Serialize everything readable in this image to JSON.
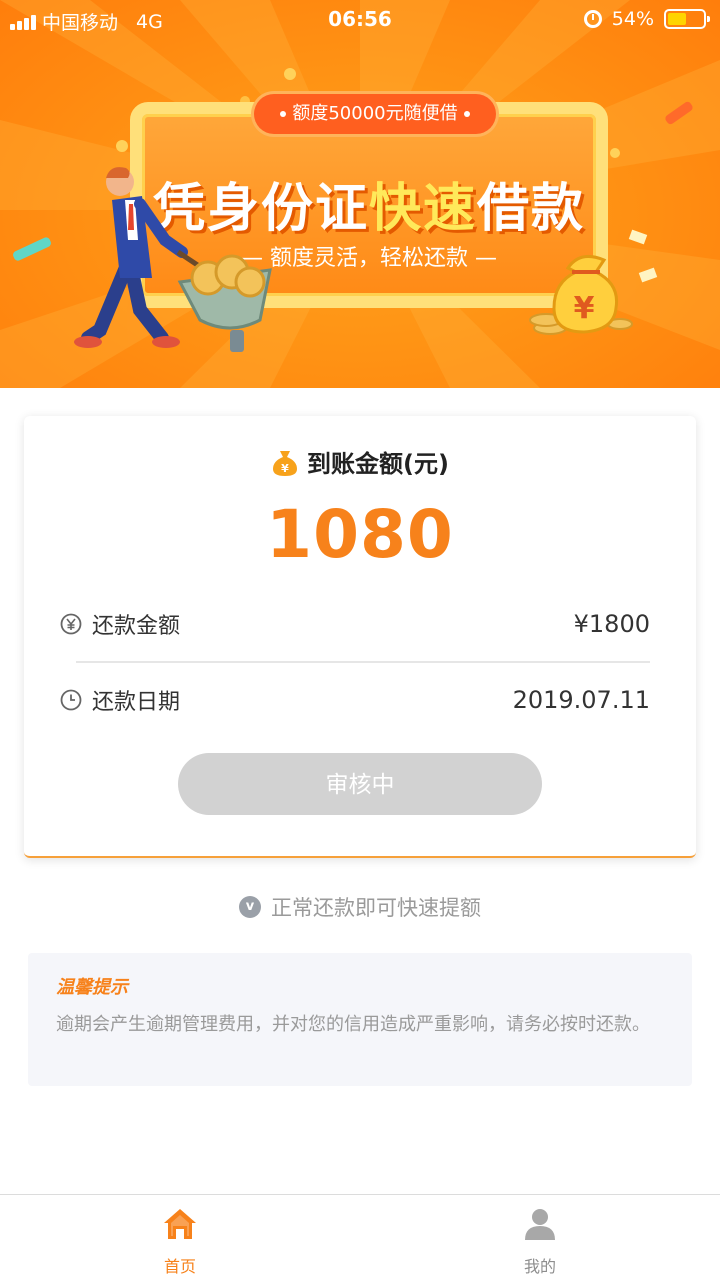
{
  "status_bar": {
    "carrier": "中国移动",
    "network": "4G",
    "time": "06:56",
    "battery_percent": "54%",
    "battery_level": 0.54
  },
  "banner": {
    "pill_text": "额度50000元随便借",
    "headline_part1": "凭身份证",
    "headline_highlight": "快速",
    "headline_part2": "借款",
    "subline": "— 额度灵活，轻松还款 —",
    "coin_symbol": "¥"
  },
  "card": {
    "title": "到账金额(元)",
    "amount": "1080",
    "repay_amount_label": "还款金额",
    "repay_amount_value": "¥1800",
    "repay_date_label": "还款日期",
    "repay_date_value": "2019.07.11",
    "status_button": "审核中"
  },
  "tip": {
    "icon_text": "v",
    "text": "正常还款即可快速提额"
  },
  "notice": {
    "title": "温馨提示",
    "body": "逾期会产生逾期管理费用，并对您的信用造成严重影响，请务必按时还款。"
  },
  "tabbar": {
    "home_label": "首页",
    "me_label": "我的"
  },
  "colors": {
    "accent": "#f7821b",
    "banner_orange": "#ff9314",
    "disabled_button": "#d2d2d2"
  }
}
